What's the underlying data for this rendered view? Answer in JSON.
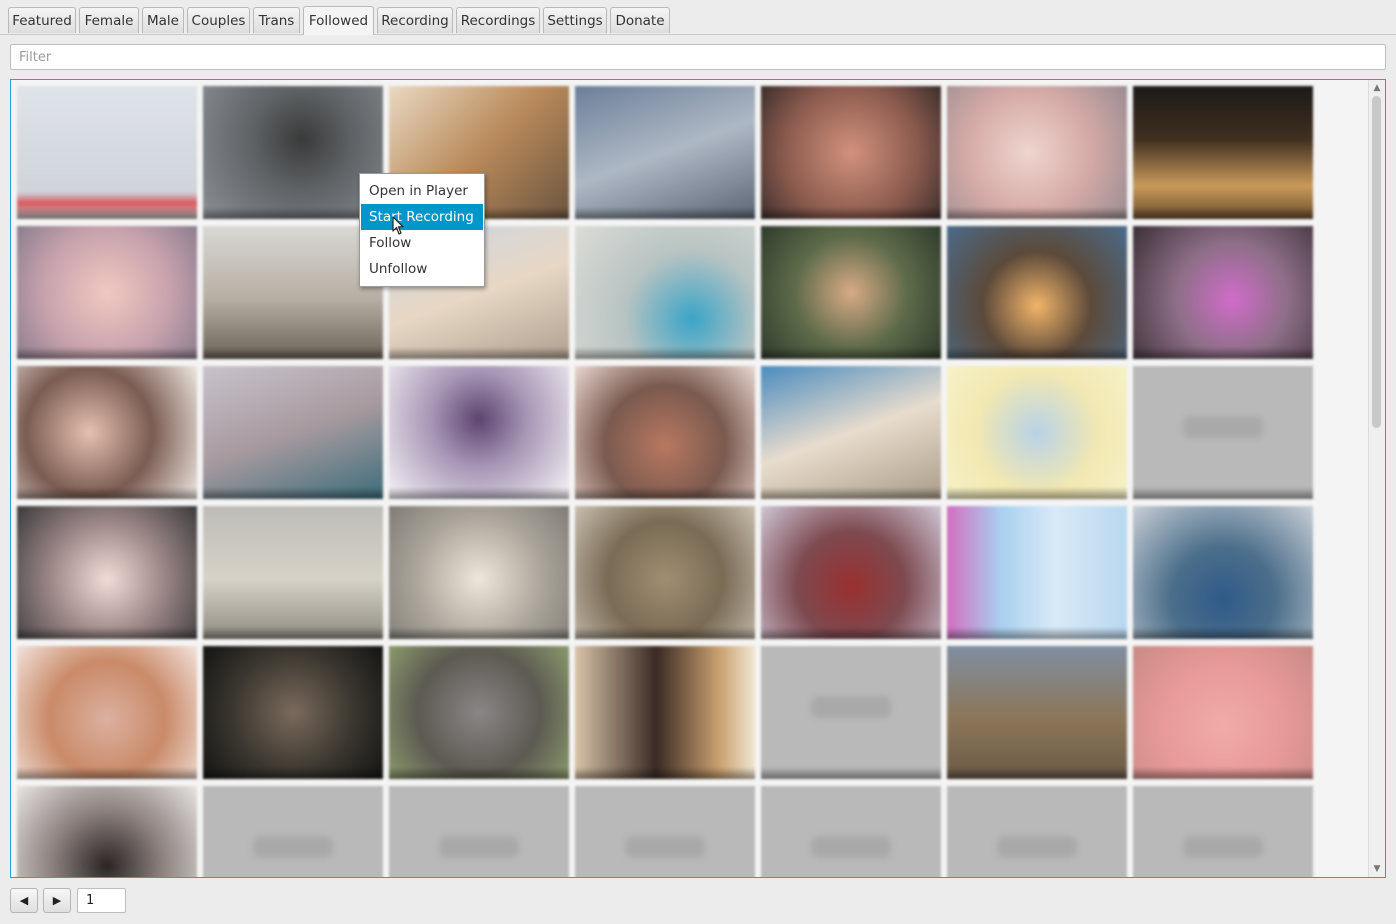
{
  "tabs": [
    {
      "label": "Featured",
      "selected": false
    },
    {
      "label": "Female",
      "selected": false
    },
    {
      "label": "Male",
      "selected": false
    },
    {
      "label": "Couples",
      "selected": false
    },
    {
      "label": "Trans",
      "selected": false
    },
    {
      "label": "Followed",
      "selected": true
    },
    {
      "label": "Recording",
      "selected": false
    },
    {
      "label": "Recordings",
      "selected": false
    },
    {
      "label": "Settings",
      "selected": false
    },
    {
      "label": "Donate",
      "selected": false
    }
  ],
  "filter": {
    "placeholder": "Filter",
    "value": ""
  },
  "context_menu": {
    "items": [
      {
        "label": "Open in Player",
        "highlighted": false
      },
      {
        "label": "Start Recording",
        "highlighted": true
      },
      {
        "label": "Follow",
        "highlighted": false
      },
      {
        "label": "Unfollow",
        "highlighted": false
      }
    ]
  },
  "pager": {
    "prev_icon": "triangle-left-icon",
    "next_icon": "triangle-right-icon",
    "page": "1"
  },
  "colors": {
    "accent": "#0096c9",
    "focus_border": "#2b9fd6"
  }
}
